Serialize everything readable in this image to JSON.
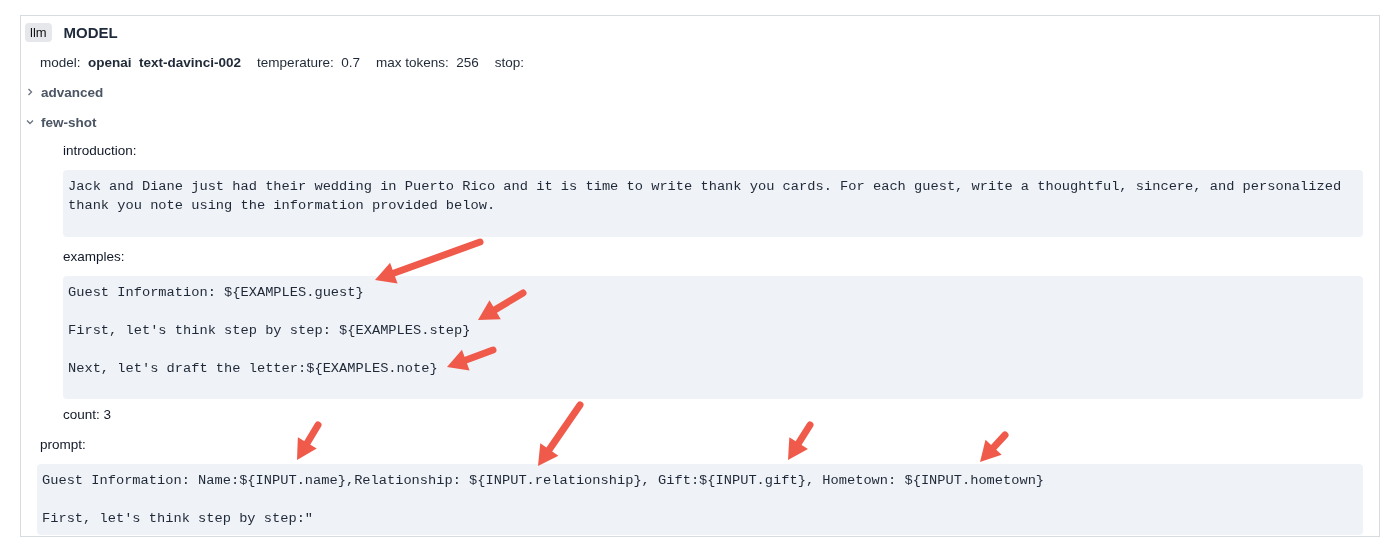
{
  "node": {
    "badge": "llm",
    "title": "MODEL"
  },
  "settings": [
    {
      "label": "model:",
      "value": "openai  text-davinci-002",
      "bold": true
    },
    {
      "label": "temperature:",
      "value": "0.7",
      "bold": false
    },
    {
      "label": "max tokens:",
      "value": "256",
      "bold": false
    },
    {
      "label": "stop:",
      "bold": false
    }
  ],
  "sections": [
    {
      "label": "advanced",
      "expanded": false
    },
    {
      "label": "few-shot",
      "expanded": true
    }
  ],
  "few_shot": {
    "introduction_label": "introduction:",
    "introduction": "Jack and Diane just had their wedding in Puerto Rico and it is time to write thank you cards. For each guest, write a thoughtful, sincere, and personalized thank you note using the information provided below.",
    "examples_label": "examples:",
    "examples": [
      "Guest Information: ${EXAMPLES.guest}",
      "First, let's think step by step: ${EXAMPLES.step}",
      "Next, let's draft the letter:${EXAMPLES.note}"
    ],
    "count_label": "count:",
    "count": "3"
  },
  "prompt": {
    "label": "prompt:",
    "lines": [
      "Guest Information: Name:${INPUT.name},Relationship: ${INPUT.relationship}, Gift:${INPUT.gift}, Hometown: ${INPUT.hometown}",
      "First, let's think step by step:\""
    ]
  }
}
